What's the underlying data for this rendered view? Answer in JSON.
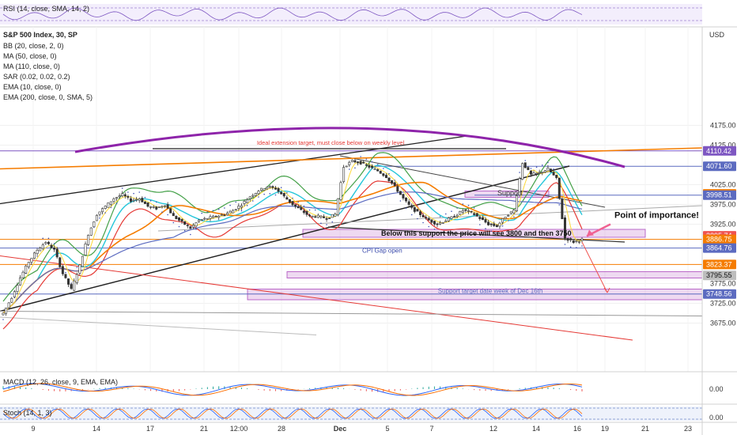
{
  "chart_data": {
    "type": "candlestick",
    "symbol": "S&P 500 Index, 30, SP",
    "currency": "USD",
    "price_range": [
      3630,
      4185
    ],
    "legend": [
      "BB (20, close, 2, 0)",
      "MA (50, close, 0)",
      "MA (110, close, 0)",
      "SAR (0.02, 0.02, 0.2)",
      "EMA (10, close, 0)",
      "EMA (200, close, 0, SMA, 5)"
    ],
    "y_ticks": [
      "4175.00",
      "4125.00",
      "4025.00",
      "3975.00",
      "3925.00",
      "3775.00",
      "3725.00",
      "3675.00"
    ],
    "price_labels": [
      {
        "text": "4110.42",
        "value": 4110.42,
        "color": "#7e57c2"
      },
      {
        "text": "4071.60",
        "value": 4071.6,
        "color": "#5c6bc0"
      },
      {
        "text": "4001.78",
        "value": 4001.78,
        "color": "#f57c00"
      },
      {
        "text": "3998.51",
        "value": 3998.51,
        "color": "#5c6bc0"
      },
      {
        "text": "3895.74",
        "value": 3895.74,
        "color": "#ef5350"
      },
      {
        "text": "3886.75",
        "value": 3886.75,
        "color": "#f57c00"
      },
      {
        "text": "3864.76",
        "value": 3864.76,
        "color": "#5c6bc0"
      },
      {
        "text": "3823.37",
        "value": 3823.37,
        "color": "#f57c00"
      },
      {
        "text": "3795.55",
        "value": 3795.55,
        "color": "#bdbdbd"
      },
      {
        "text": "3748.56",
        "value": 3748.56,
        "color": "#5c6bc0"
      }
    ],
    "x_ticks": [
      "9",
      "14",
      "17",
      "21",
      "12:00",
      "28",
      "Dec",
      "5",
      "7",
      "12",
      "14",
      "16",
      "19",
      "21",
      "23"
    ],
    "annotations": [
      {
        "text": "Ideal extension target, must close below on weekly level"
      },
      {
        "text": "Support"
      },
      {
        "text": "Point of importance!"
      },
      {
        "text": "Below this support the price will see 3800 and then 3750"
      },
      {
        "text": "CPI Gap open"
      },
      {
        "text": "Support target date week of Dec 16th"
      }
    ],
    "close_path": [
      3700,
      3740,
      3790,
      3830,
      3860,
      3880,
      3860,
      3800,
      3760,
      3820,
      3900,
      3950,
      3970,
      3990,
      4000,
      3985,
      3990,
      3970,
      3965,
      3975,
      3945,
      3930,
      3915,
      3935,
      3940,
      3945,
      3950,
      3960,
      3975,
      3995,
      4010,
      4020,
      4015,
      3995,
      3975,
      3960,
      3945,
      3945,
      3940,
      3950,
      4070,
      4085,
      4080,
      4070,
      4060,
      4045,
      4020,
      3990,
      3965,
      3950,
      3935,
      3925,
      3935,
      3945,
      3960,
      3955,
      3940,
      3925,
      3920,
      3945,
      3960,
      4080,
      4050,
      4055,
      4065,
      4040,
      3890,
      3880,
      3886
    ],
    "panels": {
      "rsi": {
        "label": "RSI (14, close, SMA, 14, 2)"
      },
      "macd": {
        "label": "MACD (12, 26, close, 9, EMA, EMA)",
        "tick": "0.00"
      },
      "stoch": {
        "label": "Stoch (14, 1, 3)",
        "tick": "0.00"
      }
    },
    "grid": true
  }
}
